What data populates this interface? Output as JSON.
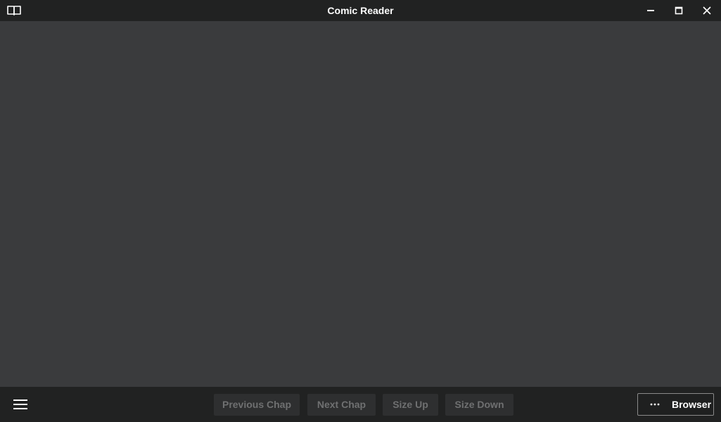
{
  "window": {
    "title": "Comic Reader",
    "app_icon": "open-book-icon",
    "controls": [
      "minimize-icon",
      "maximize-icon",
      "close-icon"
    ]
  },
  "toolbar": {
    "menu_icon": "hamburger-menu-icon",
    "previous_label": "Previous Chap",
    "next_label": "Next Chap",
    "size_up_label": "Size Up",
    "size_down_label": "Size Down",
    "browser_icon": "more-dots-icon",
    "browser_label": "Browser"
  },
  "colors": {
    "titlebar_bg": "#212222",
    "content_bg": "#3a3b3d",
    "disabled_button_bg": "#2e2f30",
    "disabled_button_text": "#6f7071",
    "text": "#ffffff"
  }
}
